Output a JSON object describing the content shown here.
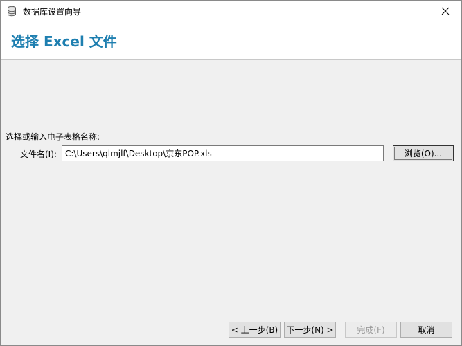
{
  "window": {
    "title": "数据库设置向导"
  },
  "header": {
    "title": "选择 Excel 文件"
  },
  "form": {
    "prompt": "选择或输入电子表格名称:",
    "file_label": "文件名(I):",
    "file_value": "C:\\Users\\qlmjlf\\Desktop\\京东POP.xls",
    "browse_label": "浏览(O)..."
  },
  "footer": {
    "prev_label": "< 上一步(B)",
    "next_label": "下一步(N) >",
    "finish_label": "完成(F)",
    "cancel_label": "取消"
  }
}
